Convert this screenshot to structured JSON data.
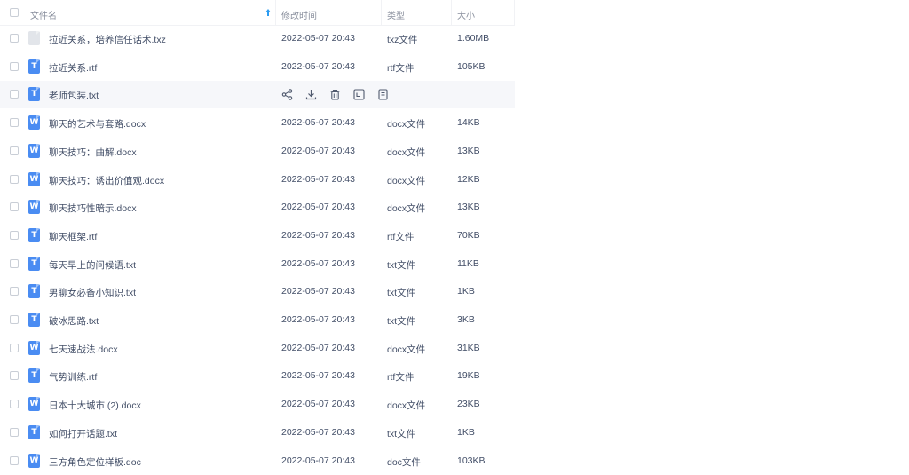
{
  "header": {
    "name": "文件名",
    "time": "修改时间",
    "type": "类型",
    "size": "大小",
    "sort_icon": "sort-ascending-icon"
  },
  "colors": {
    "icon_blue": "#4a8cf2",
    "icon_grey": "#e2e5ea",
    "hover_row": "#f6f7fa",
    "sort_arrow": "#2b9cf2"
  },
  "hover_actions": [
    "share-icon",
    "download-icon",
    "delete-icon",
    "move-icon",
    "more-icon"
  ],
  "files": [
    {
      "name": "拉近关系，培养信任话术.txz",
      "time": "2022-05-07 20:43",
      "type": "txz文件",
      "size": "1.60MB",
      "icon": "z",
      "hover": false
    },
    {
      "name": "拉近关系.rtf",
      "time": "2022-05-07 20:43",
      "type": "rtf文件",
      "size": "105KB",
      "icon": "t",
      "hover": false
    },
    {
      "name": "老师包装.txt",
      "time": "",
      "type": "",
      "size": "",
      "icon": "t",
      "hover": true
    },
    {
      "name": "聊天的艺术与套路.docx",
      "time": "2022-05-07 20:43",
      "type": "docx文件",
      "size": "14KB",
      "icon": "w",
      "hover": false
    },
    {
      "name": "聊天技巧：曲解.docx",
      "time": "2022-05-07 20:43",
      "type": "docx文件",
      "size": "13KB",
      "icon": "w",
      "hover": false
    },
    {
      "name": "聊天技巧：诱出价值观.docx",
      "time": "2022-05-07 20:43",
      "type": "docx文件",
      "size": "12KB",
      "icon": "w",
      "hover": false
    },
    {
      "name": "聊天技巧性暗示.docx",
      "time": "2022-05-07 20:43",
      "type": "docx文件",
      "size": "13KB",
      "icon": "w",
      "hover": false
    },
    {
      "name": "聊天框架.rtf",
      "time": "2022-05-07 20:43",
      "type": "rtf文件",
      "size": "70KB",
      "icon": "t",
      "hover": false
    },
    {
      "name": "每天早上的问候语.txt",
      "time": "2022-05-07 20:43",
      "type": "txt文件",
      "size": "11KB",
      "icon": "t",
      "hover": false
    },
    {
      "name": "男聊女必备小知识.txt",
      "time": "2022-05-07 20:43",
      "type": "txt文件",
      "size": "1KB",
      "icon": "t",
      "hover": false
    },
    {
      "name": "破冰思路.txt",
      "time": "2022-05-07 20:43",
      "type": "txt文件",
      "size": "3KB",
      "icon": "t",
      "hover": false
    },
    {
      "name": "七天速战法.docx",
      "time": "2022-05-07 20:43",
      "type": "docx文件",
      "size": "31KB",
      "icon": "w",
      "hover": false
    },
    {
      "name": "气势训练.rtf",
      "time": "2022-05-07 20:43",
      "type": "rtf文件",
      "size": "19KB",
      "icon": "t",
      "hover": false
    },
    {
      "name": "日本十大城市 (2).docx",
      "time": "2022-05-07 20:43",
      "type": "docx文件",
      "size": "23KB",
      "icon": "w",
      "hover": false
    },
    {
      "name": "如何打开话题.txt",
      "time": "2022-05-07 20:43",
      "type": "txt文件",
      "size": "1KB",
      "icon": "t",
      "hover": false
    },
    {
      "name": "三方角色定位样板.doc",
      "time": "2022-05-07 20:43",
      "type": "doc文件",
      "size": "103KB",
      "icon": "w",
      "hover": false
    }
  ]
}
